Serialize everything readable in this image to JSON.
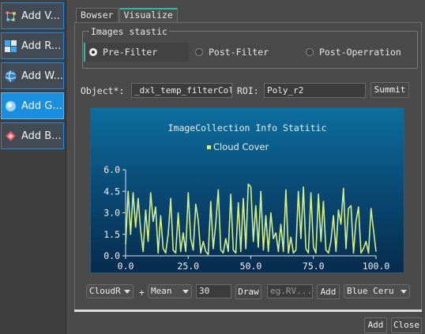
{
  "sidebar": {
    "items": [
      {
        "label": "Add V...",
        "icon": "vector-layer-icon",
        "active": false
      },
      {
        "label": "Add R...",
        "icon": "raster-layer-icon",
        "active": false
      },
      {
        "label": "Add W...",
        "icon": "wms-layer-icon",
        "active": false
      },
      {
        "label": "Add G...",
        "icon": "gee-layer-icon",
        "active": true
      },
      {
        "label": "Add B...",
        "icon": "basemap-layer-icon",
        "active": false
      }
    ]
  },
  "tabs": [
    {
      "label": "Bowser",
      "active": false
    },
    {
      "label": "Visualize",
      "active": true
    }
  ],
  "images_group": {
    "title": "Images stastic",
    "options": [
      {
        "label": "Pre-Filter",
        "checked": true
      },
      {
        "label": "Post-Filter",
        "checked": false
      },
      {
        "label": "Post-Operration",
        "checked": false
      }
    ]
  },
  "object_row": {
    "object_label": "Object*:",
    "object_value": "_dxl_temp_filterCol",
    "roi_label": "ROI:",
    "roi_value": "Poly_r2",
    "submit_label": "Summit"
  },
  "chart_data": {
    "type": "line",
    "title": "ImageCollection Info Statitic",
    "legend": [
      "Cloud Cover"
    ],
    "legend_position": "top-center",
    "series_color": "#d4ee8a",
    "xlim": [
      0,
      100
    ],
    "ylim": [
      0,
      6
    ],
    "xticks": [
      "0.0",
      "25.0",
      "50.0",
      "75.0",
      "100.0"
    ],
    "yticks": [
      "0.0",
      "1.5",
      "3.0",
      "4.5",
      "6.0"
    ],
    "grid": false,
    "series": [
      {
        "name": "Cloud Cover",
        "x": [
          0,
          1,
          2,
          3,
          4,
          5,
          6,
          7,
          8,
          9,
          10,
          11,
          12,
          13,
          14,
          15,
          16,
          17,
          18,
          19,
          20,
          21,
          22,
          23,
          24,
          25,
          26,
          27,
          28,
          29,
          30,
          31,
          32,
          33,
          34,
          35,
          36,
          37,
          38,
          39,
          40,
          41,
          42,
          43,
          44,
          45,
          46,
          47,
          48,
          49,
          50,
          51,
          52,
          53,
          54,
          55,
          56,
          57,
          58,
          59,
          60,
          61,
          62,
          63,
          64,
          65,
          66,
          67,
          68,
          69,
          70,
          71,
          72,
          73,
          74,
          75,
          76,
          77,
          78,
          79,
          80,
          81,
          82,
          83,
          84,
          85,
          86,
          87,
          88,
          89,
          90,
          91,
          92,
          93,
          94,
          95,
          96,
          97,
          98,
          99,
          100
        ],
        "y": [
          0.8,
          4.5,
          1.5,
          4.4,
          2.0,
          4.0,
          1.8,
          0.3,
          3.2,
          1.0,
          4.4,
          2.4,
          3.4,
          0.2,
          2.8,
          0.5,
          0.2,
          1.5,
          4.0,
          0.4,
          0.2,
          3.0,
          0.3,
          1.6,
          0.3,
          4.4,
          1.2,
          0.4,
          3.6,
          2.5,
          0.2,
          1.0,
          0.3,
          0.1,
          3.8,
          0.5,
          2.2,
          4.6,
          0.4,
          0.2,
          1.2,
          0.3,
          4.3,
          0.4,
          0.2,
          3.7,
          0.3,
          4.0,
          0.5,
          5.0,
          4.8,
          1.0,
          3.5,
          0.6,
          4.5,
          0.4,
          2.8,
          0.3,
          3.0,
          1.2,
          1.6,
          0.3,
          2.2,
          0.3,
          4.6,
          0.2,
          1.3,
          0.2,
          0.4,
          4.5,
          1.2,
          4.8,
          0.5,
          0.2,
          4.4,
          0.6,
          0.2,
          4.3,
          1.0,
          3.8,
          0.4,
          0.2,
          1.0,
          2.8,
          0.3,
          3.2,
          2.2,
          4.7,
          0.5,
          3.3,
          3.5,
          0.2,
          2.4,
          3.4,
          0.2,
          0.5,
          1.0,
          0.2,
          3.3,
          1.8,
          0.3
        ]
      }
    ]
  },
  "controls": {
    "band": "CloudR",
    "plus": "+",
    "reducer": "Mean",
    "count": "30",
    "draw_label": "Draw",
    "expr_placeholder": "eg.RV...",
    "add_label": "Add",
    "color": "Blue Ceru"
  },
  "footer": {
    "add_label": "Add",
    "close_label": "Close"
  }
}
